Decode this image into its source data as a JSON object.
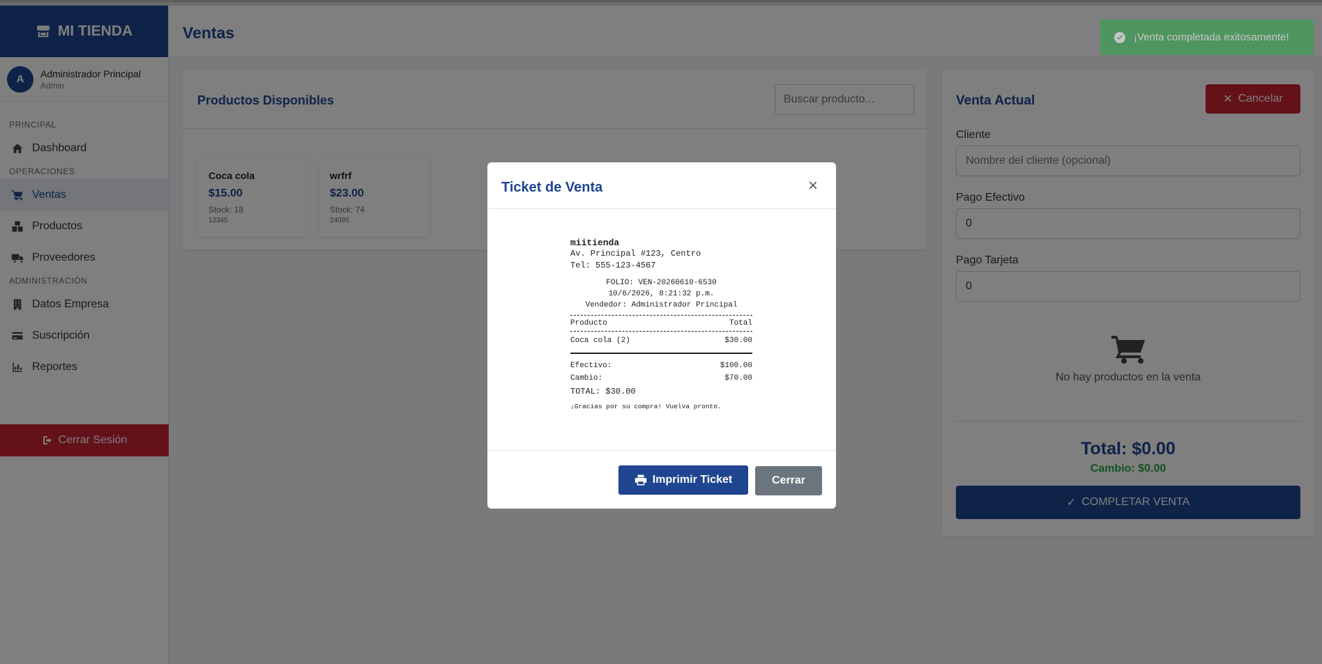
{
  "brand": {
    "name": "MI TIENDA",
    "icon": "store-icon"
  },
  "user": {
    "initial": "A",
    "name": "Administrador Principal",
    "role": "Admin"
  },
  "nav": {
    "sections": {
      "principal": "PRINCIPAL",
      "operaciones": "OPERACIONES",
      "administracion": "ADMINISTRACIÓN"
    },
    "items": {
      "dashboard": "Dashboard",
      "ventas": "Ventas",
      "productos": "Productos",
      "proveedores": "Proveedores",
      "datos_empresa": "Datos Empresa",
      "suscripcion": "Suscripción",
      "reportes": "Reportes"
    },
    "active": "ventas",
    "logout": "Cerrar Sesión"
  },
  "header": {
    "title": "Ventas"
  },
  "toast": {
    "message": "¡Venta completada exitosamente!",
    "color": "#28a745"
  },
  "products": {
    "title": "Productos Disponibles",
    "search_placeholder": "Buscar producto...",
    "items": [
      {
        "name": "Coca cola",
        "price": "$15.00",
        "stock": "Stock: 18",
        "code": "12345"
      },
      {
        "name": "wrfrf",
        "price": "$23.00",
        "stock": "Stock: 74",
        "code": "24095"
      }
    ]
  },
  "sale": {
    "title": "Venta Actual",
    "cancel_label": "Cancelar",
    "client_label": "Cliente",
    "client_placeholder": "Nombre del cliente (opcional)",
    "cash_label": "Pago Efectivo",
    "cash_value": "0",
    "card_label": "Pago Tarjeta",
    "card_value": "0",
    "empty_text": "No hay productos en la venta",
    "total": "Total: $0.00",
    "change": "Cambio: $0.00",
    "complete_label": "COMPLETAR VENTA"
  },
  "modal": {
    "title": "Ticket de Venta",
    "close_symbol": "×",
    "print_label": "Imprimir Ticket",
    "close_label": "Cerrar",
    "receipt": {
      "business": "miitienda",
      "address": "Av. Principal #123, Centro",
      "phone": "Tel: 555-123-4567",
      "folio": "FOLIO: VEN-20260610-6530",
      "datetime": "10/6/2026, 8:21:32 p.m.",
      "seller": "Vendedor: Administrador Principal",
      "col_product": "Producto",
      "col_total": "Total",
      "line_item": "Coca cola (2)",
      "line_total": "$30.00",
      "cash_label": "Efectivo:",
      "cash_value": "$100.00",
      "change_label": "Cambio:",
      "change_value": "$70.00",
      "total": "TOTAL: $30.00",
      "thanks": "¡Gracias por su compra! Vuelva pronto."
    }
  },
  "colors": {
    "primary": "#1f4590",
    "danger": "#c82333",
    "success": "#28a745",
    "secondary": "#6c757d"
  }
}
